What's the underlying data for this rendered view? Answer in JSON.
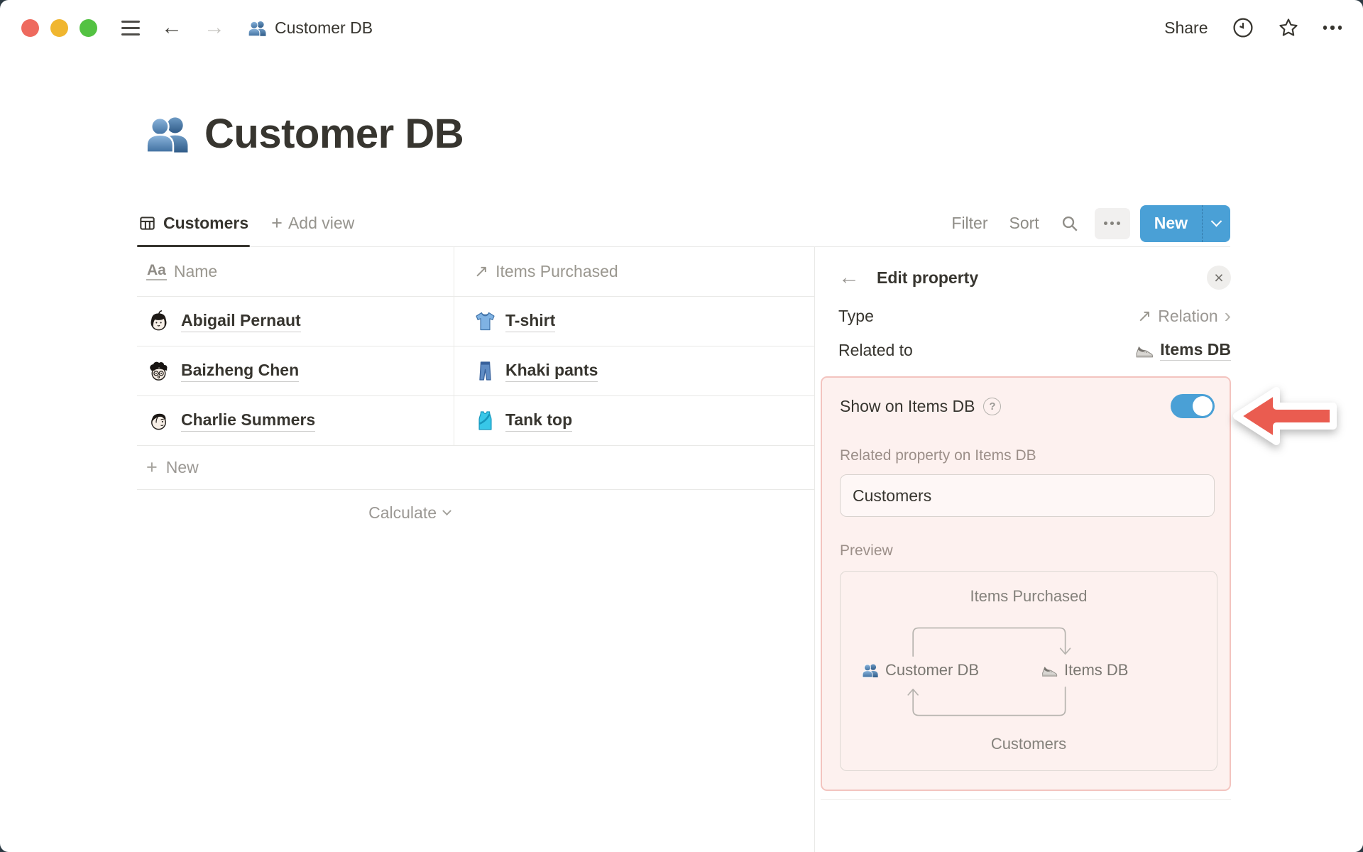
{
  "topbar": {
    "breadcrumb": {
      "icon": "people-icon",
      "label": "Customer DB"
    },
    "share_label": "Share",
    "history_icon": "clock-icon",
    "favorite_icon": "star-icon",
    "more_icon": "ellipsis-icon"
  },
  "page": {
    "icon": "people-icon",
    "title": "Customer DB"
  },
  "toolbar": {
    "tab": {
      "icon": "table-icon",
      "label": "Customers"
    },
    "add_view_label": "Add view",
    "filter_label": "Filter",
    "sort_label": "Sort",
    "search_icon": "search-icon",
    "more_icon": "ellipsis-icon",
    "new_label": "New"
  },
  "table": {
    "columns": [
      {
        "icon": "title-icon",
        "label": "Name"
      },
      {
        "icon": "relation-arrow-icon",
        "label": "Items Purchased"
      }
    ],
    "rows": [
      {
        "avatar": "avatar-abigail",
        "name": "Abigail Pernaut",
        "item_icon": "tshirt-icon",
        "item": "T-shirt"
      },
      {
        "avatar": "avatar-baizheng",
        "name": "Baizheng Chen",
        "item_icon": "jeans-icon",
        "item": "Khaki pants"
      },
      {
        "avatar": "avatar-charlie",
        "name": "Charlie Summers",
        "item_icon": "tanktop-icon",
        "item": "Tank top"
      }
    ],
    "new_row_label": "New",
    "calculate_label": "Calculate"
  },
  "edit_panel": {
    "title": "Edit property",
    "type": {
      "label": "Type",
      "value": "Relation",
      "value_icon": "relation-arrow-icon"
    },
    "related_to": {
      "label": "Related to",
      "value": "Items DB",
      "value_icon": "sneaker-icon"
    },
    "show_on": {
      "label": "Show on Items DB",
      "enabled": true
    },
    "related_property": {
      "label": "Related property on Items DB",
      "value": "Customers"
    },
    "preview": {
      "label": "Preview",
      "top_label": "Items Purchased",
      "left": {
        "icon": "people-icon",
        "label": "Customer DB"
      },
      "right": {
        "icon": "sneaker-icon",
        "label": "Items DB"
      },
      "bottom_label": "Customers"
    }
  },
  "colors": {
    "accent_blue": "#4aa0d6",
    "highlight_bg": "#fdf1ef",
    "highlight_border": "#f3c4bf",
    "annotation_red": "#ea5c50",
    "backdrop": "#2c3a43"
  }
}
